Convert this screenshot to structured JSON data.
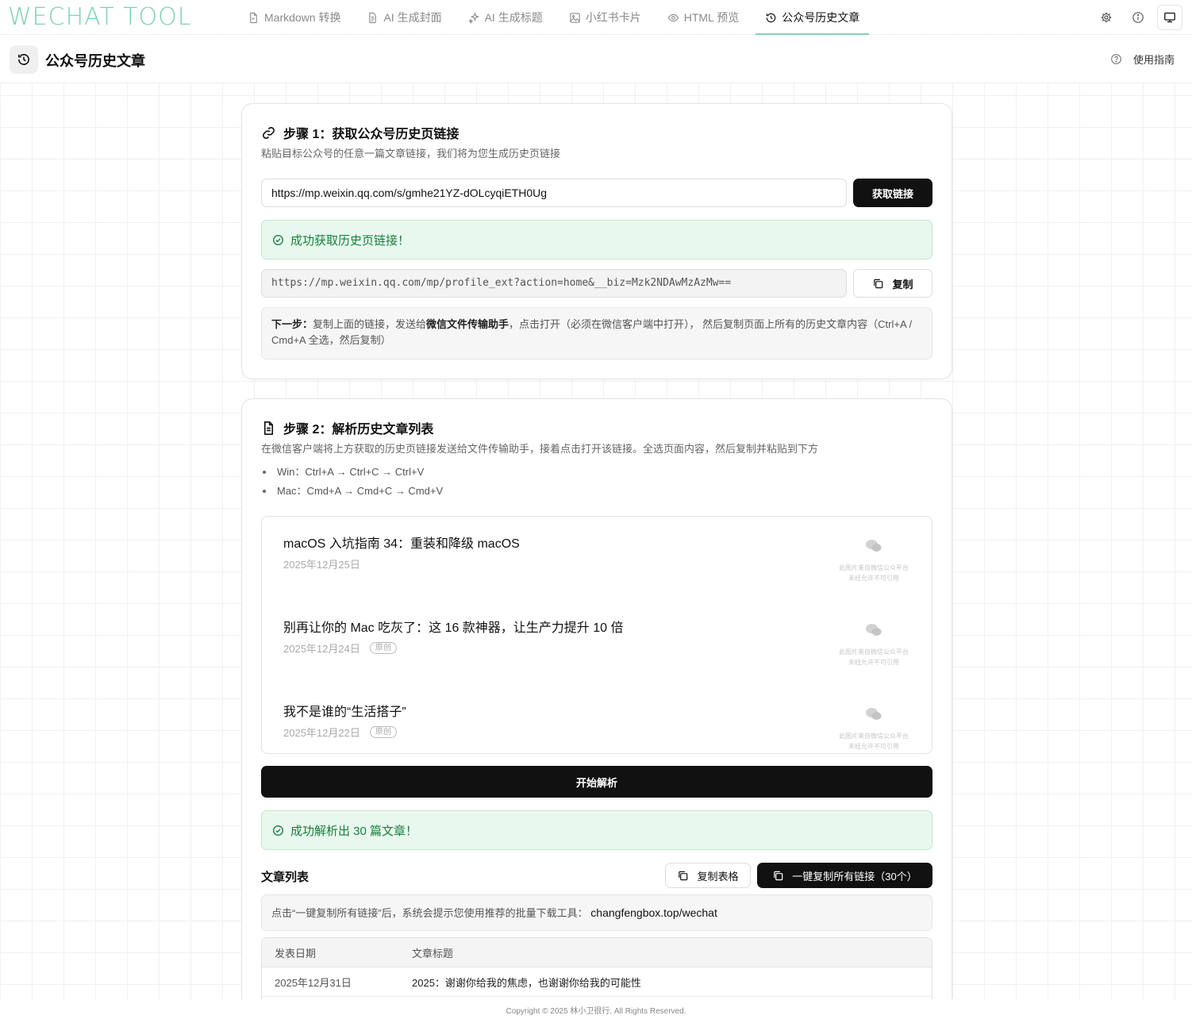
{
  "app": {
    "logo": "WECHAT TOOL",
    "accent": "#7fd2b0"
  },
  "nav": {
    "tabs": [
      {
        "label": "Markdown 转换",
        "icon": "file-convert-icon"
      },
      {
        "label": "AI 生成封面",
        "icon": "document-icon"
      },
      {
        "label": "AI 生成标题",
        "icon": "sparkles-icon"
      },
      {
        "label": "小红书卡片",
        "icon": "image-icon"
      },
      {
        "label": "HTML 预览",
        "icon": "eye-icon"
      },
      {
        "label": "公众号历史文章",
        "icon": "history-icon",
        "active": true
      }
    ],
    "icons": [
      "settings-icon",
      "info-icon",
      "monitor-icon"
    ]
  },
  "page": {
    "title": "公众号历史文章",
    "guide": "使用指南"
  },
  "step1": {
    "title": "步骤 1：获取公众号历史页链接",
    "desc": "粘贴目标公众号的任意一篇文章链接，我们将为您生成历史页链接",
    "input_value": "https://mp.weixin.qq.com/s/gmhe21YZ-dOLcyqiETH0Ug",
    "fetch_button": "获取链接",
    "success": "成功获取历史页链接！",
    "result_url": "https://mp.weixin.qq.com/mp/profile_ext?action=home&__biz=Mzk2NDAwMzAzMw==",
    "copy_button": "复制",
    "next_label": "下一步：",
    "next_text_1": "复制上面的链接，发送给",
    "next_bold": "微信文件传输助手",
    "next_text_2": "，点击打开（必须在微信客户端中打开）， 然后复制页面上所有的历史文章内容（Ctrl+A / Cmd+A 全选，然后复制）"
  },
  "step2": {
    "title": "步骤 2：解析历史文章列表",
    "desc": "在微信客户端将上方获取的历史页链接发送给文件传输助手，接着点击打开该链接。全选页面内容，然后复制并粘贴到下方",
    "shortcuts": [
      "Win：Ctrl+A → Ctrl+C → Ctrl+V",
      "Mac：Cmd+A → Cmd+C → Cmd+V"
    ],
    "articles": [
      {
        "title": "macOS 入坑指南 34：重装和降级 macOS",
        "date": "2025年12月25日",
        "badge": ""
      },
      {
        "title": "别再让你的 Mac 吃灰了：这 16 款神器，让生产力提升 10 倍",
        "date": "2025年12月24日",
        "badge": "原创"
      },
      {
        "title": "我不是谁的“生活搭子”",
        "date": "2025年12月22日",
        "badge": "原创"
      }
    ],
    "thumb_caption_1": "此图片来自微信公众平台",
    "thumb_caption_2": "未经允许不可引用",
    "parse_button": "开始解析",
    "success": "成功解析出 30 篇文章！",
    "list_title": "文章列表",
    "copy_table_button": "复制表格",
    "copy_all_button": "一键复制所有链接（30个）",
    "tip_text": "点击“一键复制所有链接”后，系统会提示您使用推荐的批量下载工具：",
    "tip_link": "changfengbox.top/wechat",
    "table": {
      "headers": [
        "发表日期",
        "文章标题"
      ],
      "rows": [
        [
          "2025年12月31日",
          "2025：谢谢你给我的焦虑，也谢谢你给我的可能性"
        ]
      ]
    }
  },
  "footer": "Copyright © 2025 林小卫很行. All Rights Reserved."
}
